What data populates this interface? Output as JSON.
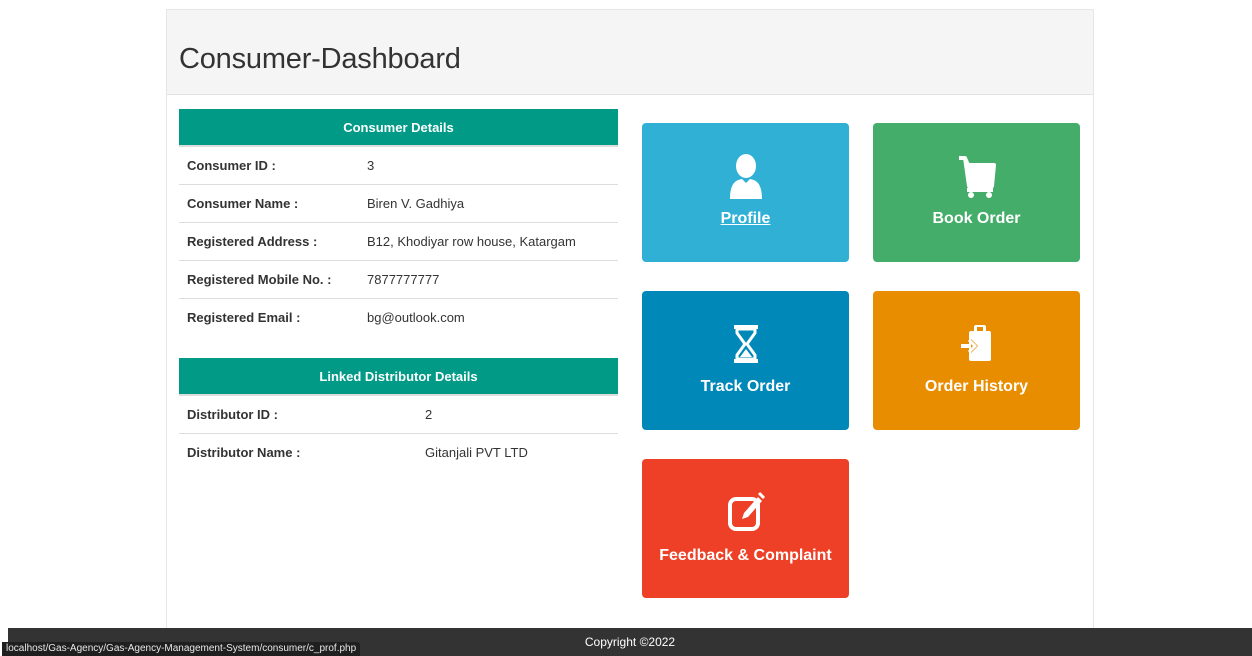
{
  "page": {
    "title": "Consumer-Dashboard"
  },
  "consumer": {
    "heading": "Consumer Details",
    "rows": [
      {
        "label": "Consumer ID :",
        "value": "3"
      },
      {
        "label": "Consumer Name :",
        "value": "Biren V. Gadhiya"
      },
      {
        "label": "Registered Address :",
        "value": "B12, Khodiyar row house, Katargam"
      },
      {
        "label": "Registered Mobile No. :",
        "value": "7877777777"
      },
      {
        "label": "Registered Email :",
        "value": "bg@outlook.com"
      }
    ]
  },
  "distributor": {
    "heading": "Linked Distributor Details",
    "rows": [
      {
        "label": "Distributor ID :",
        "value": "2"
      },
      {
        "label": "Distributor Name :",
        "value": "Gitanjali PVT LTD"
      }
    ]
  },
  "tiles": {
    "profile": {
      "label": "Profile",
      "icon": "user-icon",
      "color": "#31b0d5"
    },
    "book_order": {
      "label": "Book Order",
      "icon": "cart-icon",
      "color": "#45ad6a"
    },
    "track_order": {
      "label": "Track Order",
      "icon": "hourglass-icon",
      "color": "#0088b8"
    },
    "order_history": {
      "label": "Order History",
      "icon": "clipboard-icon",
      "color": "#e98d00"
    },
    "feedback": {
      "label": "Feedback & Complaint",
      "icon": "edit-icon",
      "color": "#ee4026"
    }
  },
  "footer": {
    "copyright": "Copyright ©2022"
  },
  "status_bar": {
    "url": "localhost/Gas-Agency/Gas-Agency-Management-System/consumer/c_prof.php"
  },
  "colors": {
    "table_header": "#009a87",
    "footer_bg": "#333333"
  }
}
